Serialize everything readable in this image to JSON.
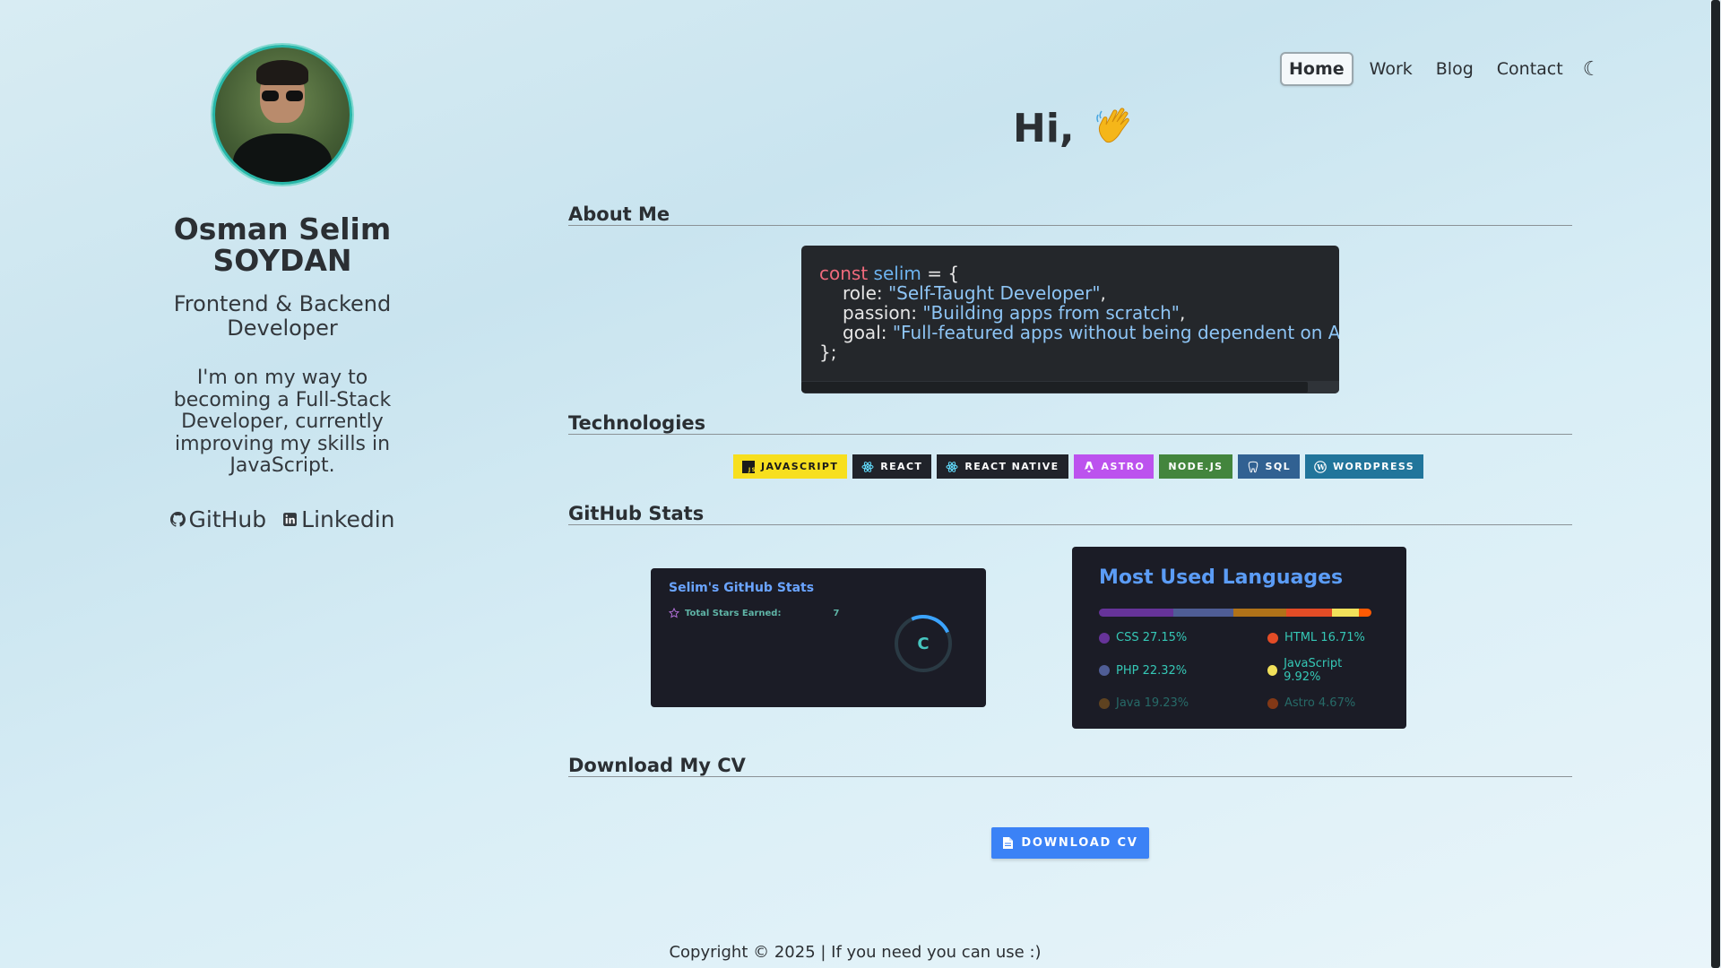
{
  "profile": {
    "name": "Osman Selim SOYDAN",
    "role": "Frontend & Backend Developer",
    "bio": "I'm on my way to becoming a Full-Stack Developer, currently improving my skills in JavaScript.",
    "links": [
      {
        "label": "GitHub",
        "icon": "github-icon"
      },
      {
        "label": "Linkedin",
        "icon": "linkedin-icon"
      }
    ]
  },
  "nav": {
    "items": [
      {
        "label": "Home",
        "active": true
      },
      {
        "label": "Work",
        "active": false
      },
      {
        "label": "Blog",
        "active": false
      },
      {
        "label": "Contact",
        "active": false
      }
    ],
    "theme_icon": "moon-icon"
  },
  "greeting": "Hi,",
  "sections": {
    "about": "About Me",
    "technologies": "Technologies",
    "github_stats": "GitHub Stats",
    "download_cv": "Download My CV"
  },
  "code": {
    "kw": "const",
    "var": "selim",
    "op": " = {",
    "lines": [
      {
        "key": "role: ",
        "value": "\"Self-Taught Developer\""
      },
      {
        "key": "passion: ",
        "value": "\"Building apps from scratch\""
      },
      {
        "key": "goal: ",
        "value": "\"Full-featured apps without being dependent on A"
      }
    ],
    "close": "};",
    "colors": {
      "keyword": "#ef6a7c",
      "variable": "#6db3ef",
      "string": "#8ec5f5",
      "background": "#24272b"
    }
  },
  "technologies": [
    {
      "label": "JAVASCRIPT",
      "bg": "#f7df1e",
      "fg": "#1a1a1a",
      "icon": "javascript-icon"
    },
    {
      "label": "REACT",
      "bg": "#20232a",
      "fg": "#ffffff",
      "icon": "react-icon"
    },
    {
      "label": "REACT NATIVE",
      "bg": "#20232a",
      "fg": "#ffffff",
      "icon": "react-icon"
    },
    {
      "label": "ASTRO",
      "bg": "#bc52ee",
      "fg": "#ffffff",
      "icon": "astro-icon"
    },
    {
      "label": "NODE.JS",
      "bg": "#43853d",
      "fg": "#ffffff",
      "icon": ""
    },
    {
      "label": "SQL",
      "bg": "#316192",
      "fg": "#ffffff",
      "icon": "postgresql-icon"
    },
    {
      "label": "WORDPRESS",
      "bg": "#21759b",
      "fg": "#ffffff",
      "icon": "wordpress-icon"
    }
  ],
  "github_stats": {
    "title": "Selim's GitHub Stats",
    "rows": [
      {
        "label": "Total Stars Earned:",
        "value": "7",
        "icon": "star-icon"
      }
    ],
    "grade": "C"
  },
  "languages": {
    "title": "Most Used Languages",
    "items": [
      {
        "label": "CSS 27.15%",
        "percent": 27.15,
        "color": "#663399",
        "faded": false
      },
      {
        "label": "HTML 16.71%",
        "percent": 16.71,
        "color": "#e34c26",
        "faded": false
      },
      {
        "label": "PHP 22.32%",
        "percent": 22.32,
        "color": "#4f5d95",
        "faded": false
      },
      {
        "label": "JavaScript 9.92%",
        "percent": 9.92,
        "color": "#f1e05a",
        "faded": false
      },
      {
        "label": "Java 19.23%",
        "percent": 19.23,
        "color": "#b07219",
        "faded": true
      },
      {
        "label": "Astro 4.67%",
        "percent": 4.67,
        "color": "#ff5a03",
        "faded": true
      }
    ],
    "bar_order": [
      "CSS",
      "PHP",
      "Java",
      "HTML",
      "JavaScript",
      "Astro"
    ]
  },
  "download_button": {
    "label": "DOWNLOAD CV",
    "icon": "file-icon"
  },
  "footer": "Copyright © 2025 | If you need you can use :)"
}
